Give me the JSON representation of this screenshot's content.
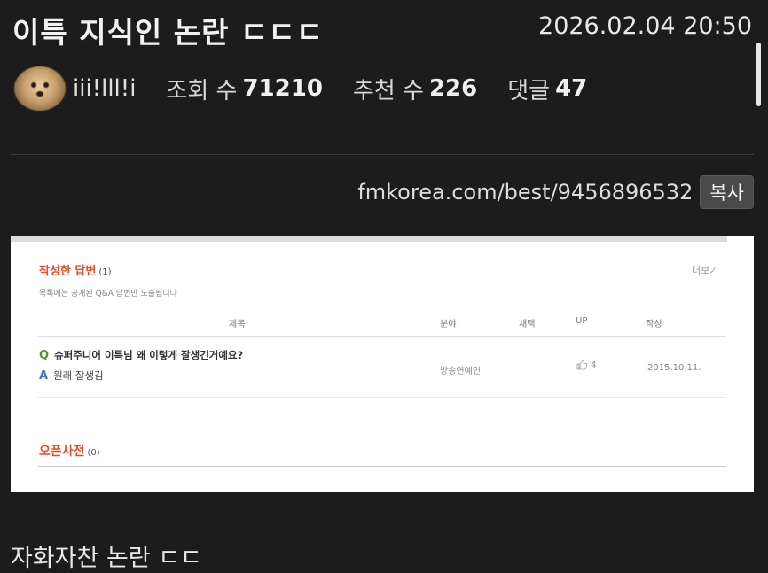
{
  "post": {
    "title": "이특 지식인 논란 ㄷㄷㄷ",
    "date": "2026.02.04 20:50",
    "author": "iii!lll!i",
    "views_label": "조회 수",
    "views": "71210",
    "recommend_label": "추천 수",
    "recommend": "226",
    "comments_label": "댓글",
    "comments": "47",
    "url": "fmkorea.com/best/9456896532",
    "copy_label": "복사",
    "caption": "자화자찬 논란 ㄷㄷ"
  },
  "embed": {
    "section_title": "작성한 답변",
    "section_count": "(1)",
    "more_label": "더보기",
    "note": "목록에는 공개된 Q&A 답변만 노출됩니다",
    "columns": [
      "제목",
      "분야",
      "채택",
      "UP",
      "작성"
    ],
    "question_mark": "Q",
    "question": "슈퍼주니어 이특님 왜 이렇게 잘생긴거예요?",
    "answer_mark": "A",
    "answer": "원래 잘생김",
    "category": "방송연예인",
    "up_count": "4",
    "written_date": "2015.10.11.",
    "dict_title": "오픈사전",
    "dict_count": "(0)"
  },
  "icons": {
    "thumb": "thumbs-up-icon",
    "avatar": "dog-avatar"
  }
}
